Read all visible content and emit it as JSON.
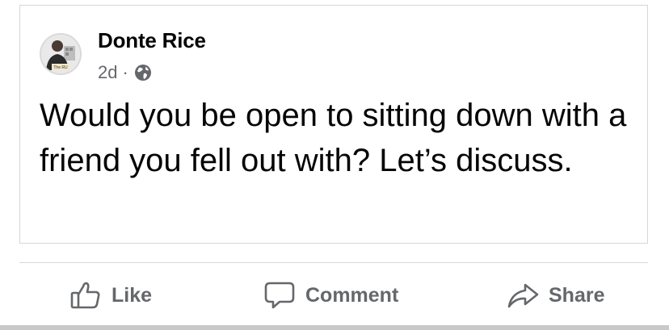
{
  "post": {
    "author": "Donte Rice",
    "avatar_caption": "The RU",
    "timestamp": "2d",
    "separator": "·",
    "privacy_icon": "globe-icon",
    "text": "Would you be open to sitting down with a friend you fell out with? Let’s discuss."
  },
  "actions": {
    "like": {
      "label": "Like",
      "icon": "thumbs-up-icon"
    },
    "comment": {
      "label": "Comment",
      "icon": "comment-icon"
    },
    "share": {
      "label": "Share",
      "icon": "share-arrow-icon"
    }
  },
  "colors": {
    "text_primary": "#050505",
    "text_secondary": "#65676b",
    "border": "#d6d6d6"
  }
}
